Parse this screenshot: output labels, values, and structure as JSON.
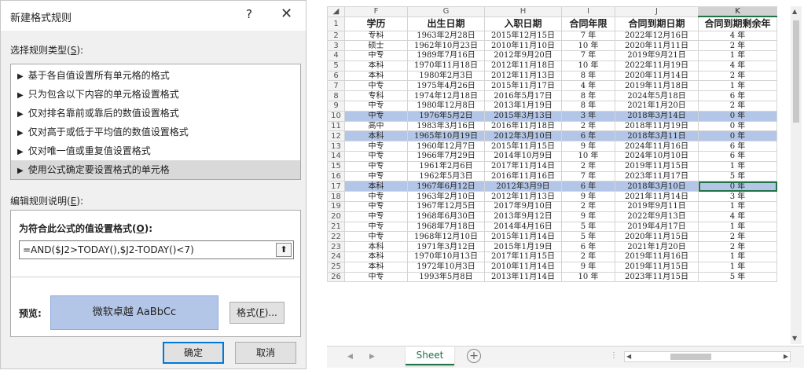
{
  "dialog": {
    "title": "新建格式规则",
    "help": "?",
    "close": "✕",
    "select_type_label": "选择规则类型(",
    "select_type_key": "S",
    "select_type_end": "):",
    "rules": [
      "基于各自值设置所有单元格的格式",
      "只为包含以下内容的单元格设置格式",
      "仅对排名靠前或靠后的数值设置格式",
      "仅对高于或低于平均值的数值设置格式",
      "仅对唯一值或重复值设置格式",
      "使用公式确定要设置格式的单元格"
    ],
    "edit_label": "编辑规则说明(",
    "edit_key": "E",
    "edit_end": "):",
    "formula_title": "为符合此公式的值设置格式(",
    "formula_key": "O",
    "formula_end": "):",
    "formula_value": "=AND($J2>TODAY(),$J2-TODAY()<7)",
    "collapse_icon": "⬆",
    "preview_label": "预览:",
    "preview_text": "微软卓越  AaBbCc",
    "preview_color": "#b4c6e7",
    "format_button": "格式(",
    "format_key": "F",
    "format_end": ")...",
    "ok_button": "确定",
    "cancel_button": "取消"
  },
  "sheet": {
    "corner": "◢",
    "columns": [
      "F",
      "G",
      "H",
      "I",
      "J",
      "K"
    ],
    "headers": [
      "学历",
      "出生日期",
      "入职日期",
      "合同年限",
      "合同到期日期",
      "合同到期剩余年"
    ],
    "rows": [
      {
        "n": "2",
        "c": [
          "专科",
          "1963年2月28日",
          "2015年12月15日",
          "7 年",
          "2022年12月16日",
          "4 年"
        ],
        "hl": false
      },
      {
        "n": "3",
        "c": [
          "硕士",
          "1962年10月23日",
          "2010年11月10日",
          "10 年",
          "2020年11月11日",
          "2 年"
        ],
        "hl": false
      },
      {
        "n": "4",
        "c": [
          "中专",
          "1989年7月16日",
          "2012年9月20日",
          "7 年",
          "2019年9月21日",
          "1 年"
        ],
        "hl": false
      },
      {
        "n": "5",
        "c": [
          "本科",
          "1970年11月18日",
          "2012年11月18日",
          "10 年",
          "2022年11月19日",
          "4 年"
        ],
        "hl": false
      },
      {
        "n": "6",
        "c": [
          "本科",
          "1980年2月3日",
          "2012年11月13日",
          "8 年",
          "2020年11月14日",
          "2 年"
        ],
        "hl": false
      },
      {
        "n": "7",
        "c": [
          "中专",
          "1975年4月26日",
          "2015年11月17日",
          "4 年",
          "2019年11月18日",
          "1 年"
        ],
        "hl": false
      },
      {
        "n": "8",
        "c": [
          "专科",
          "1974年12月18日",
          "2016年5月17日",
          "8 年",
          "2024年5月18日",
          "6 年"
        ],
        "hl": false
      },
      {
        "n": "9",
        "c": [
          "中专",
          "1980年12月8日",
          "2013年1月19日",
          "8 年",
          "2021年1月20日",
          "2 年"
        ],
        "hl": false
      },
      {
        "n": "10",
        "c": [
          "中专",
          "1976年5月2日",
          "2015年3月13日",
          "3 年",
          "2018年3月14日",
          "0 年"
        ],
        "hl": true
      },
      {
        "n": "11",
        "c": [
          "高中",
          "1983年3月16日",
          "2016年11月18日",
          "2 年",
          "2018年11月19日",
          "0 年"
        ],
        "hl": false
      },
      {
        "n": "12",
        "c": [
          "本科",
          "1965年10月19日",
          "2012年3月10日",
          "6 年",
          "2018年3月11日",
          "0 年"
        ],
        "hl": true
      },
      {
        "n": "13",
        "c": [
          "中专",
          "1960年12月7日",
          "2015年11月15日",
          "9 年",
          "2024年11月16日",
          "6 年"
        ],
        "hl": false
      },
      {
        "n": "14",
        "c": [
          "中专",
          "1966年7月29日",
          "2014年10月9日",
          "10 年",
          "2024年10月10日",
          "6 年"
        ],
        "hl": false
      },
      {
        "n": "15",
        "c": [
          "中专",
          "1961年2月6日",
          "2017年11月14日",
          "2 年",
          "2019年11月15日",
          "1 年"
        ],
        "hl": false
      },
      {
        "n": "16",
        "c": [
          "中专",
          "1962年5月3日",
          "2016年11月16日",
          "7 年",
          "2023年11月17日",
          "5 年"
        ],
        "hl": false
      },
      {
        "n": "17",
        "c": [
          "本科",
          "1967年6月12日",
          "2012年3月9日",
          "6 年",
          "2018年3月10日",
          "0 年"
        ],
        "hl": true
      },
      {
        "n": "18",
        "c": [
          "中专",
          "1963年2月10日",
          "2012年11月13日",
          "9 年",
          "2021年11月14日",
          "3 年"
        ],
        "hl": false
      },
      {
        "n": "19",
        "c": [
          "中专",
          "1967年12月5日",
          "2017年9月10日",
          "2 年",
          "2019年9月11日",
          "1 年"
        ],
        "hl": false
      },
      {
        "n": "20",
        "c": [
          "中专",
          "1968年6月30日",
          "2013年9月12日",
          "9 年",
          "2022年9月13日",
          "4 年"
        ],
        "hl": false
      },
      {
        "n": "21",
        "c": [
          "中专",
          "1968年7月18日",
          "2014年4月16日",
          "5 年",
          "2019年4月17日",
          "1 年"
        ],
        "hl": false
      },
      {
        "n": "22",
        "c": [
          "中专",
          "1968年12月10日",
          "2015年11月14日",
          "5 年",
          "2020年11月15日",
          "2 年"
        ],
        "hl": false
      },
      {
        "n": "23",
        "c": [
          "本科",
          "1971年3月12日",
          "2015年1月19日",
          "6 年",
          "2021年1月20日",
          "2 年"
        ],
        "hl": false
      },
      {
        "n": "24",
        "c": [
          "本科",
          "1970年10月13日",
          "2017年11月15日",
          "2 年",
          "2019年11月16日",
          "1 年"
        ],
        "hl": false
      },
      {
        "n": "25",
        "c": [
          "本科",
          "1972年10月3日",
          "2010年11月14日",
          "9 年",
          "2019年11月15日",
          "1 年"
        ],
        "hl": false
      },
      {
        "n": "26",
        "c": [
          "中专",
          "1993年5月8日",
          "2013年11月14日",
          "10 年",
          "2023年11月15日",
          "5 年"
        ],
        "hl": false
      }
    ],
    "tab": "Sheet",
    "add_sheet_icon": "+",
    "nav_prev": "◀",
    "nav_next": "▶",
    "dots": "⋮",
    "scroll_up": "▲",
    "scroll_down": "▼",
    "scroll_left": "◀",
    "scroll_right": "▶",
    "highlight_color": "#b4c6e7",
    "accent_color": "#217346"
  }
}
